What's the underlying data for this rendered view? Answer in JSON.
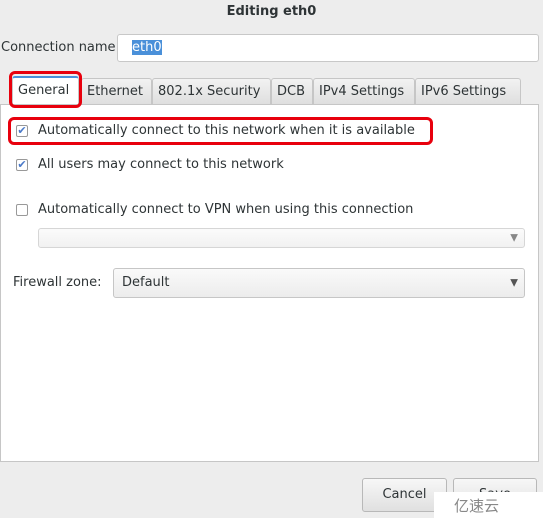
{
  "title": "Editing eth0",
  "connection_name": {
    "label": "Connection name:",
    "value": "eth0"
  },
  "tabs": [
    {
      "label": "General",
      "active": true
    },
    {
      "label": "Ethernet"
    },
    {
      "label": "802.1x Security"
    },
    {
      "label": "DCB"
    },
    {
      "label": "IPv4 Settings"
    },
    {
      "label": "IPv6 Settings"
    }
  ],
  "general": {
    "auto_connect": {
      "label": "Automatically connect to this network when it is available",
      "checked": true
    },
    "all_users": {
      "label": "All users may connect to this network",
      "checked": true
    },
    "auto_vpn": {
      "label": "Automatically connect to VPN when using this connection",
      "checked": false
    },
    "vpn_select": {
      "value": ""
    },
    "firewall": {
      "label": "Firewall zone:",
      "value": "Default"
    }
  },
  "buttons": {
    "cancel": "Cancel",
    "save": "Save"
  },
  "watermark": "亿速云",
  "colors": {
    "accent": "#4a90d9",
    "highlight": "#e8000d"
  }
}
